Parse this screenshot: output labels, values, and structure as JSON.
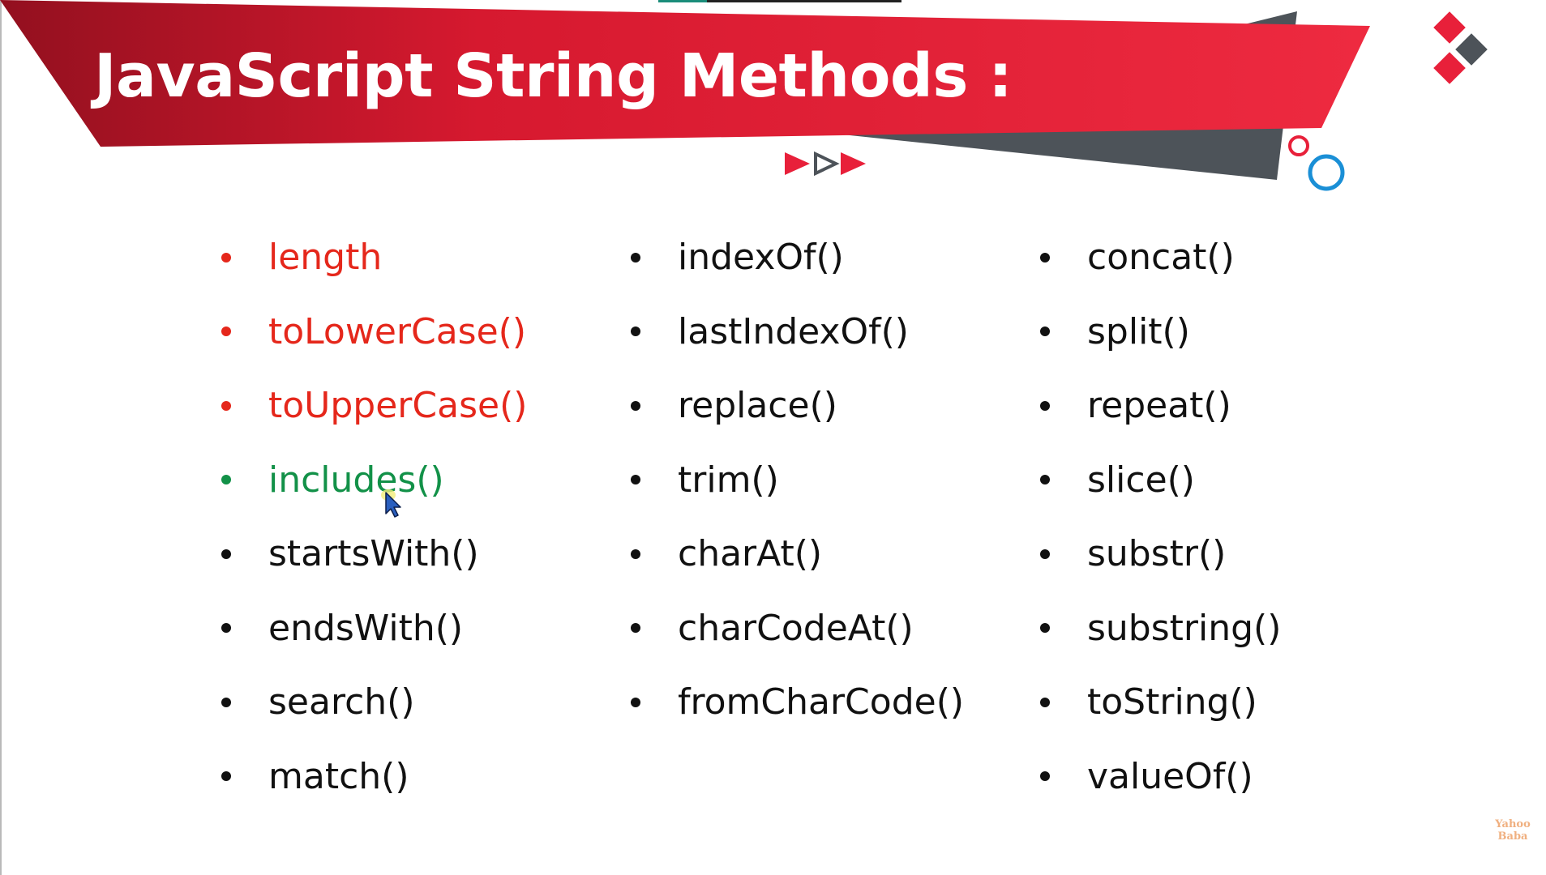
{
  "title": "JavaScript String Methods :",
  "colors": {
    "banner_red": "#e8203a",
    "banner_dark_red": "#9a0f22",
    "banner_gray": "#4d5359",
    "highlight_red": "#e5271b",
    "highlight_green": "#129148",
    "text": "#111111",
    "circle_blue": "#1a8fd6"
  },
  "decorations": {
    "arrows": [
      "play-arrow-filled",
      "play-arrow-outline",
      "play-arrow-filled"
    ],
    "diamonds": [
      "red-diamond",
      "gray-diamond",
      "red-diamond"
    ],
    "circles": [
      "small-red-ring",
      "large-blue-ring"
    ]
  },
  "columns": [
    {
      "items": [
        {
          "label": "length",
          "state": "red"
        },
        {
          "label": "toLowerCase()",
          "state": "red"
        },
        {
          "label": "toUpperCase()",
          "state": "red"
        },
        {
          "label": "includes()",
          "state": "green"
        },
        {
          "label": "startsWith()",
          "state": "normal"
        },
        {
          "label": "endsWith()",
          "state": "normal"
        },
        {
          "label": "search()",
          "state": "normal"
        },
        {
          "label": "match()",
          "state": "normal"
        }
      ]
    },
    {
      "items": [
        {
          "label": "indexOf()",
          "state": "normal"
        },
        {
          "label": "lastIndexOf()",
          "state": "normal"
        },
        {
          "label": "replace()",
          "state": "normal"
        },
        {
          "label": "trim()",
          "state": "normal"
        },
        {
          "label": "charAt()",
          "state": "normal"
        },
        {
          "label": "charCodeAt()",
          "state": "normal"
        },
        {
          "label": "fromCharCode()",
          "state": "normal"
        }
      ]
    },
    {
      "items": [
        {
          "label": "concat()",
          "state": "normal"
        },
        {
          "label": "split()",
          "state": "normal"
        },
        {
          "label": "repeat()",
          "state": "normal"
        },
        {
          "label": "slice()",
          "state": "normal"
        },
        {
          "label": "substr()",
          "state": "normal"
        },
        {
          "label": "substring()",
          "state": "normal"
        },
        {
          "label": "toString()",
          "state": "normal"
        },
        {
          "label": "valueOf()",
          "state": "normal"
        }
      ]
    }
  ],
  "logo": {
    "line1": "Yahoo",
    "line2": "Baba"
  }
}
